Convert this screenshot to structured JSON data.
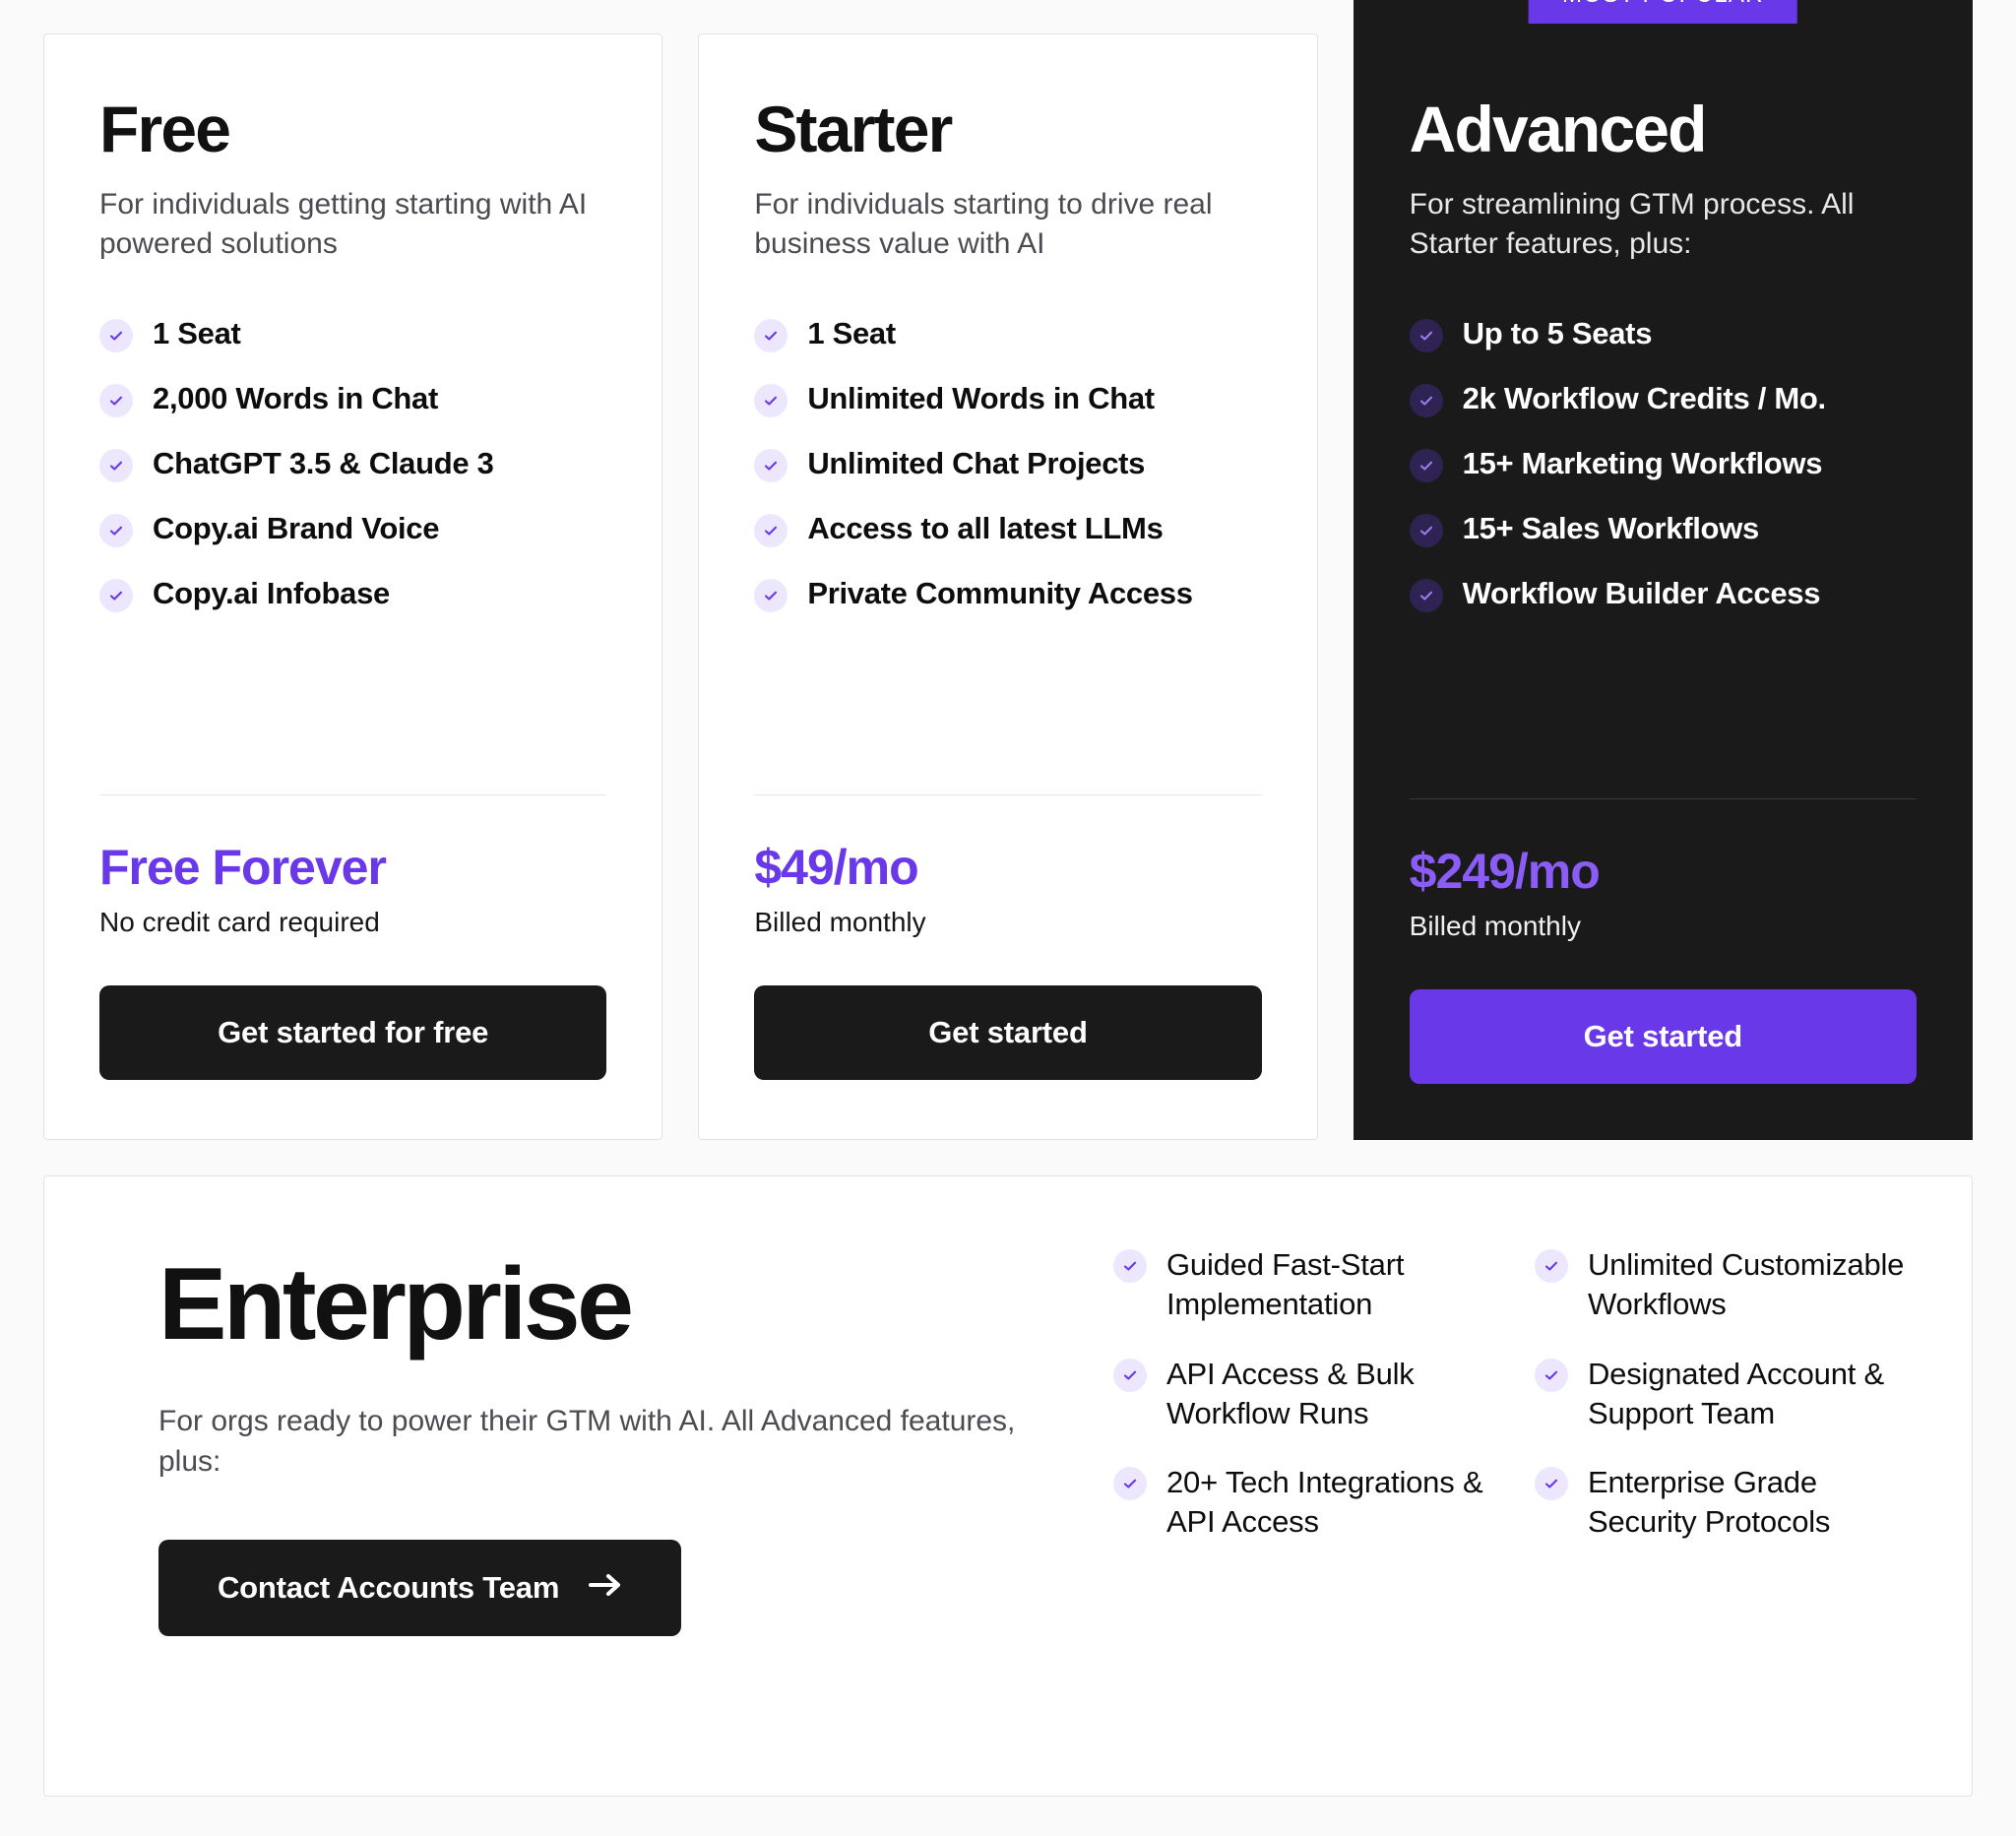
{
  "plans": [
    {
      "name": "Free",
      "description": "For individuals getting starting with AI powered solutions",
      "features": [
        "1 Seat",
        "2,000 Words in Chat",
        "ChatGPT 3.5 & Claude 3",
        "Copy.ai Brand Voice",
        "Copy.ai Infobase"
      ],
      "price": "Free Forever",
      "price_note": "No credit card required",
      "cta_label": "Get started for free"
    },
    {
      "name": "Starter",
      "description": "For individuals starting to drive real business value with AI",
      "features": [
        "1 Seat",
        "Unlimited Words in Chat",
        "Unlimited Chat Projects",
        "Access to all latest LLMs",
        "Private Community Access"
      ],
      "price": "$49/mo",
      "price_note": "Billed monthly",
      "cta_label": "Get started"
    },
    {
      "name": "Advanced",
      "badge": "MOST POPULAR",
      "description": "For streamlining GTM process. All Starter features, plus:",
      "features": [
        "Up to 5 Seats",
        "2k Workflow Credits / Mo.",
        "15+ Marketing Workflows",
        "15+ Sales Workflows",
        "Workflow Builder Access"
      ],
      "price": "$249/mo",
      "price_note": "Billed monthly",
      "cta_label": "Get started"
    }
  ],
  "enterprise": {
    "name": "Enterprise",
    "description": "For orgs ready to power their GTM with AI. All Advanced features, plus:",
    "cta_label": "Contact Accounts Team",
    "cta_icon": "arrow-right-icon",
    "columns": [
      [
        "Guided Fast-Start Implementation",
        "API Access & Bulk Workflow Runs",
        "20+ Tech Integrations & API Access"
      ],
      [
        "Unlimited Customizable Workflows",
        "Designated Account & Support Team",
        "Enterprise Grade Security Protocols"
      ]
    ]
  },
  "icons": {
    "check": "check-icon"
  },
  "colors": {
    "accent": "#6938e8",
    "accent_light": "#8b5cf6",
    "dark": "#1a1a1a",
    "check_bg": "#ece7fd",
    "check_bg_dark": "#2e2352"
  }
}
